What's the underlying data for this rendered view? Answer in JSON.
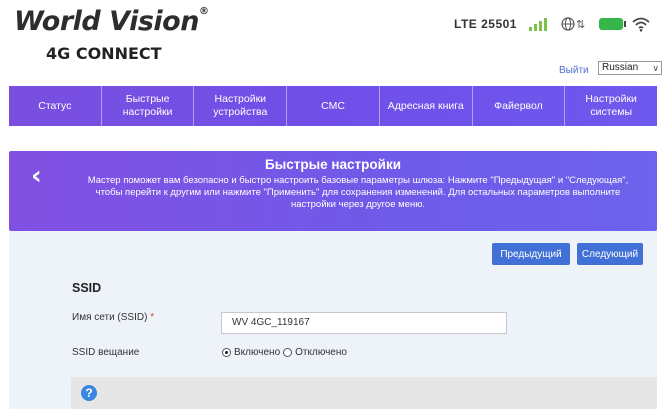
{
  "header": {
    "brand": "World Vision",
    "brand_mark": "®",
    "product": "4G CONNECT",
    "network": "LTE  25501",
    "status_icons": [
      "signal-bars-icon",
      "globe-icon",
      "transfer-arrows-icon",
      "battery-icon",
      "wifi-icon"
    ],
    "logout": "Выйти",
    "language": "Russian"
  },
  "nav": {
    "items": [
      {
        "label": "Статус"
      },
      {
        "label": "Быстрые настройки"
      },
      {
        "label": "Настройки устройства"
      },
      {
        "label": "СМС"
      },
      {
        "label": "Адресная книга"
      },
      {
        "label": "Файервол"
      },
      {
        "label": "Настройки системы"
      }
    ]
  },
  "panel": {
    "title": "Быстрые настройки",
    "description": "Мастер поможет вам безопасно и быстро настроить базовые параметры шлюза: Нажмите \"Предыдущая\" и \"Следующая\", чтобы перейти к другим или нажмите \"Применить\" для сохранения изменений. Для остальных параметров выполните настройки через другое меню."
  },
  "buttons": {
    "prev": "Предыдущий",
    "next": "Следующий"
  },
  "form": {
    "section": "SSID",
    "ssid_label": "Имя сети (SSID)",
    "required": "*",
    "ssid_value": "WV 4GC_119167",
    "broadcast_label": "SSID вещание",
    "on": "Включено",
    "off": "Отключено"
  },
  "colors": {
    "nav_gradient_start": "#7a4fe0",
    "nav_gradient_end": "#6e59ee",
    "button": "#4170d6",
    "battery": "#36b549",
    "signal": "#7cc14a"
  }
}
